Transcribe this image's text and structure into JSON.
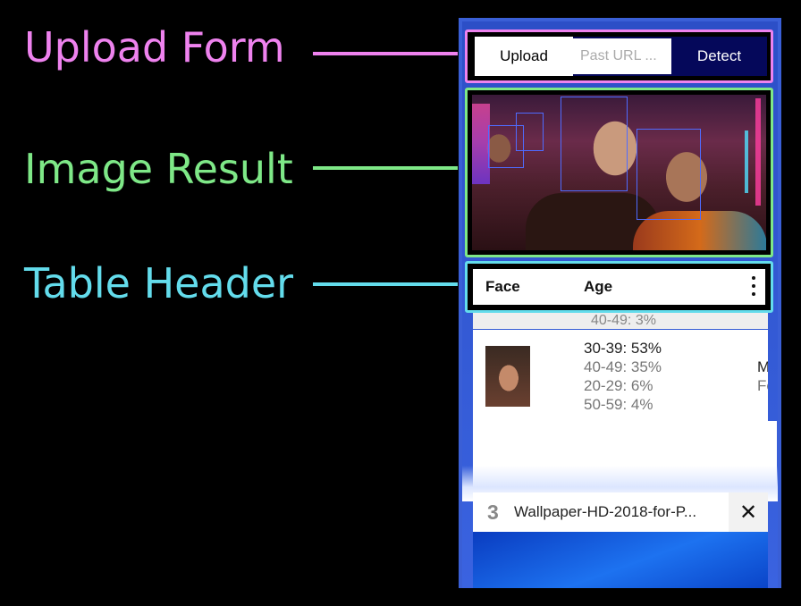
{
  "callouts": {
    "upload_form": "Upload Form",
    "image_result": "Image Result",
    "table_header": "Table Header"
  },
  "upload_form": {
    "upload_label": "Upload",
    "url_placeholder": "Past URL ...",
    "detect_label": "Detect"
  },
  "table": {
    "headers": [
      "Face",
      "Age"
    ],
    "partial_row_text": "40-49: 3%",
    "row": {
      "ages": [
        "30-39: 53%",
        "40-49: 35%",
        "20-29: 6%",
        "50-59: 4%"
      ],
      "gender": [
        "M",
        "Fe"
      ]
    }
  },
  "tab": {
    "number": "3",
    "title": "Wallpaper-HD-2018-for-P...",
    "close_symbol": "✕"
  },
  "colors": {
    "upload_callout": "#ee82ee",
    "image_callout": "#7ee887",
    "table_callout": "#63dcec",
    "face_box": "#4f6bff"
  }
}
